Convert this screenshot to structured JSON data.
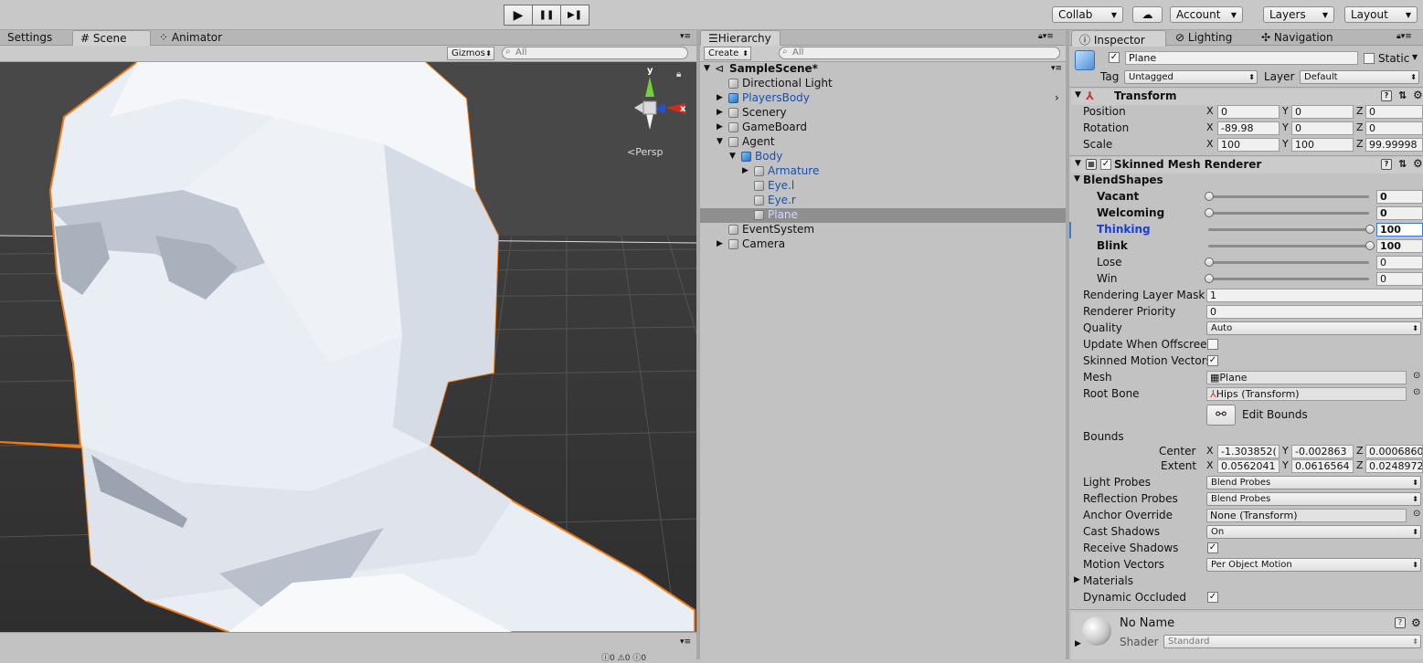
{
  "toolbar": {
    "play": "▶",
    "pause": "❚❚",
    "step": "▶❚",
    "collab": "Collab",
    "cloud": "☁",
    "account": "Account",
    "layers": "Layers",
    "layout": "Layout"
  },
  "scene_tabs": {
    "settings": "Settings",
    "scene": "Scene",
    "animator": "Animator"
  },
  "scene": {
    "gizmos": "Gizmos",
    "search_placeholder": "All",
    "persp": "Persp",
    "gizmo_y": "y",
    "gizmo_x": "x"
  },
  "hierarchy": {
    "title": "Hierarchy",
    "create": "Create",
    "search_placeholder": "All",
    "scene_name": "SampleScene*",
    "items": [
      {
        "label": "Directional Light"
      },
      {
        "label": "PlayersBody"
      },
      {
        "label": "Scenery"
      },
      {
        "label": "GameBoard"
      },
      {
        "label": "Agent"
      },
      {
        "label": "Body"
      },
      {
        "label": "Armature"
      },
      {
        "label": "Eye.l"
      },
      {
        "label": "Eye.r"
      },
      {
        "label": "Plane"
      },
      {
        "label": "EventSystem"
      },
      {
        "label": "Camera"
      }
    ]
  },
  "inspector": {
    "tabs": {
      "inspector": "Inspector",
      "lighting": "Lighting",
      "navigation": "Navigation"
    },
    "object_name": "Plane",
    "static_label": "Static",
    "tag_label": "Tag",
    "tag_value": "Untagged",
    "layer_label": "Layer",
    "layer_value": "Default",
    "transform": {
      "title": "Transform",
      "position": {
        "label": "Position",
        "x": "0",
        "y": "0",
        "z": "0"
      },
      "rotation": {
        "label": "Rotation",
        "x": "-89.98",
        "y": "0",
        "z": "0"
      },
      "scale": {
        "label": "Scale",
        "x": "100",
        "y": "100",
        "z": "99.99998"
      }
    },
    "axes": {
      "x": "X",
      "y": "Y",
      "z": "Z"
    },
    "smr": {
      "title": "Skinned Mesh Renderer",
      "blendshapes": "BlendShapes",
      "shapes": [
        {
          "label": "Vacant",
          "value": "0",
          "level": 0
        },
        {
          "label": "Welcoming",
          "value": "0",
          "level": 0
        },
        {
          "label": "Thinking",
          "value": "100",
          "level": 100
        },
        {
          "label": "Blink",
          "value": "100",
          "level": 100
        },
        {
          "label": "Lose",
          "value": "0",
          "level": 0
        },
        {
          "label": "Win",
          "value": "0",
          "level": 0
        }
      ],
      "rendering_layer_mask": {
        "label": "Rendering Layer Mask",
        "value": "1"
      },
      "renderer_priority": {
        "label": "Renderer Priority",
        "value": "0"
      },
      "quality": {
        "label": "Quality",
        "value": "Auto"
      },
      "update_offscreen": {
        "label": "Update When Offscreen"
      },
      "skinned_motion": {
        "label": "Skinned Motion Vectors"
      },
      "mesh": {
        "label": "Mesh",
        "value": "Plane"
      },
      "root_bone": {
        "label": "Root Bone",
        "value": "Hips (Transform)"
      },
      "edit_bounds": "Edit Bounds",
      "bounds": {
        "label": "Bounds",
        "center_label": "Center",
        "extent_label": "Extent",
        "center": {
          "x": "-1.303852(",
          "y": "-0.002863",
          "z": "0.0006860"
        },
        "extent": {
          "x": "0.0562041",
          "y": "0.0616564",
          "z": "0.0248972"
        }
      },
      "light_probes": {
        "label": "Light Probes",
        "value": "Blend Probes"
      },
      "reflection_probes": {
        "label": "Reflection Probes",
        "value": "Blend Probes"
      },
      "anchor_override": {
        "label": "Anchor Override",
        "value": "None (Transform)"
      },
      "cast_shadows": {
        "label": "Cast Shadows",
        "value": "On"
      },
      "receive_shadows": {
        "label": "Receive Shadows"
      },
      "motion_vectors": {
        "label": "Motion Vectors",
        "value": "Per Object Motion"
      },
      "materials": {
        "label": "Materials"
      },
      "dynamic_occluded": {
        "label": "Dynamic Occluded"
      }
    },
    "material": {
      "name": "No Name",
      "shader_label": "Shader",
      "shader_value": "Standard"
    }
  },
  "colors": {
    "selection_outline": "#f07a16",
    "accent_blue": "#1a3fd0",
    "prefab_blue": "#1b4fa8"
  },
  "statusbar": {
    "a": "0",
    "b": "0",
    "c": "0"
  }
}
